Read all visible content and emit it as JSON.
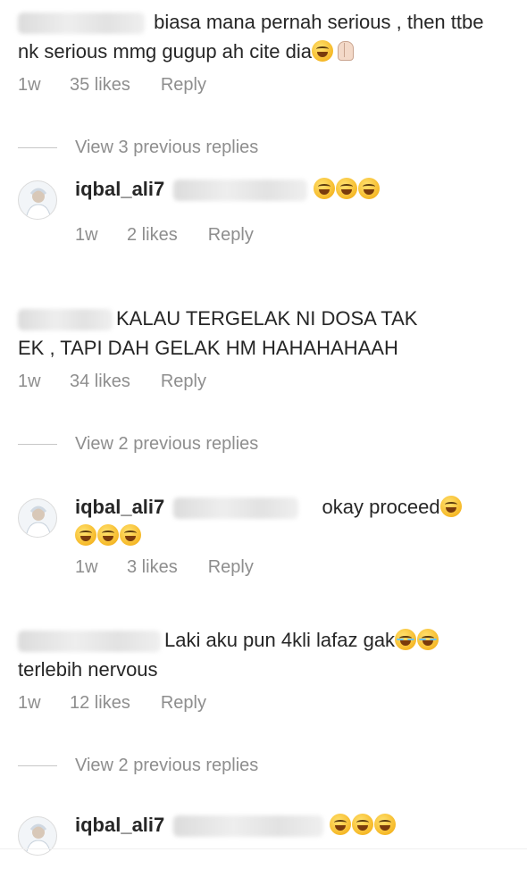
{
  "comments": [
    {
      "text": "biasa mana pernah serious , then ttbe nk serious mmg gugup ah cite dia",
      "emojis": [
        "rofl",
        "pray"
      ],
      "time": "1w",
      "likes": "35 likes",
      "reply": "Reply",
      "view_replies": "View 3 previous replies",
      "reply_item": {
        "username": "iqbal_ali7",
        "text": "",
        "emojis": [
          "rofl",
          "rofl",
          "rofl"
        ],
        "time": "1w",
        "likes": "2 likes",
        "reply": "Reply"
      }
    },
    {
      "text_line1": "KALAU TERGELAK NI DOSA TAK",
      "text_line2": "EK , TAPI DAH GELAK HM HAHAHAHAAH",
      "time": "1w",
      "likes": "34 likes",
      "reply": "Reply",
      "view_replies": "View 2 previous replies",
      "reply_item": {
        "username": "iqbal_ali7",
        "text": "okay proceed",
        "emojis": [
          "laugh",
          "rofl",
          "rofl",
          "rofl"
        ],
        "time": "1w",
        "likes": "3 likes",
        "reply": "Reply"
      }
    },
    {
      "text_line1": "Laki aku pun 4kli lafaz gak",
      "text_line2": "terlebih nervous",
      "emojis": [
        "joy",
        "joy"
      ],
      "time": "1w",
      "likes": "12 likes",
      "reply": "Reply",
      "view_replies": "View 2 previous replies",
      "reply_item": {
        "username": "iqbal_ali7",
        "text": "",
        "emojis": [
          "rofl",
          "rofl",
          "rofl"
        ]
      }
    }
  ],
  "colors": {
    "text": "#262626",
    "muted": "#8e8e8e",
    "divider": "#c7c7c7"
  }
}
